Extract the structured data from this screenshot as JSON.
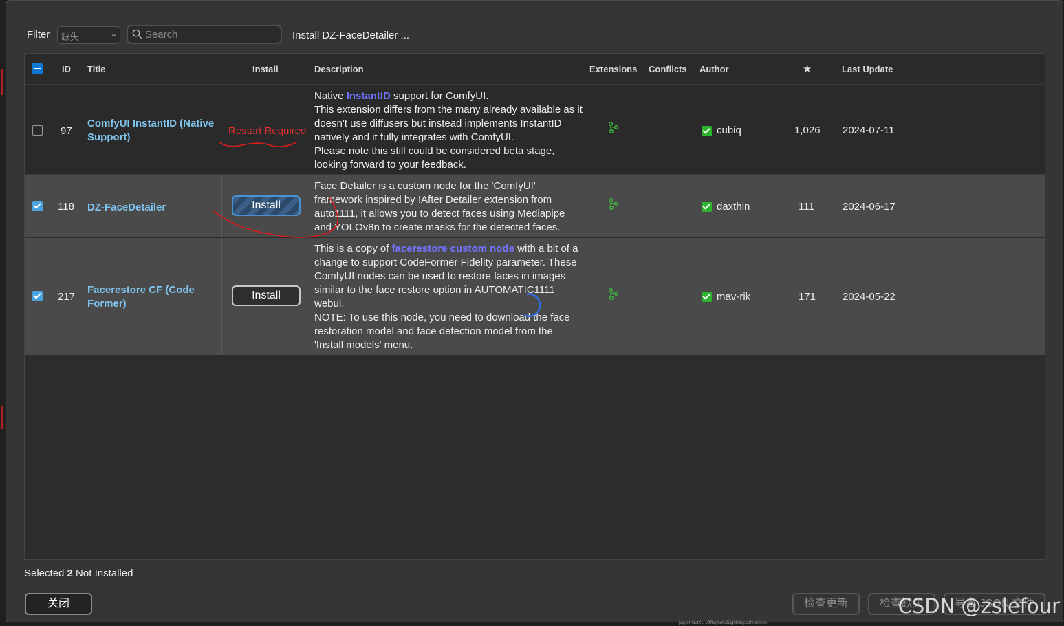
{
  "toolbar": {
    "filter_label": "Filter",
    "filter_value": "缺失",
    "search_placeholder": "Search",
    "status_message": "Install DZ-FaceDetailer ..."
  },
  "columns": {
    "id": "ID",
    "title": "Title",
    "install": "Install",
    "description": "Description",
    "extensions": "Extensions",
    "conflicts": "Conflicts",
    "author": "Author",
    "stars": "★",
    "last_update": "Last Update"
  },
  "rows": [
    {
      "checked": false,
      "id": "97",
      "title": "ComfyUI InstantID (Native Support)",
      "install_state": "Restart Required",
      "description_lines": [
        [
          "Native ",
          "InstantID",
          " support for ComfyUI."
        ],
        "This extension differs from the many already available as it",
        "doesn't use diffusers but instead implements InstantID",
        "natively and it fully integrates with ComfyUI.",
        "Please note this still could be considered beta stage,",
        "looking forward to your feedback."
      ],
      "author": "cubiq",
      "stars": "1,026",
      "last_update": "2024-07-11"
    },
    {
      "checked": true,
      "id": "118",
      "title": "DZ-FaceDetailer",
      "install_state": "Install",
      "description_lines": [
        "Face Detailer is a custom node for the 'ComfyUI'",
        "framework inspired by !After Detailer extension from",
        "auto1111, it allows you to detect faces using Mediapipe",
        "and YOLOv8n to create masks for the detected faces."
      ],
      "author": "daxthin",
      "stars": "111",
      "last_update": "2024-06-17"
    },
    {
      "checked": true,
      "id": "217",
      "title": "Facerestore CF (Code Former)",
      "install_state": "Install",
      "description_lines": [
        [
          "This is a copy of ",
          "facerestore custom node",
          " with a bit of a"
        ],
        "change to support CodeFormer Fidelity parameter. These",
        "ComfyUI nodes can be used to restore faces in images",
        "similar to the face restore option in AUTOMATIC1111",
        "webui.",
        "NOTE: To use this node, you need to download the face",
        "restoration model and face detection model from the",
        "'Install models' menu."
      ],
      "author": "mav-rik",
      "stars": "171",
      "last_update": "2024-05-22"
    }
  ],
  "footer": {
    "selected_prefix": "Selected ",
    "selected_count": "2",
    "selected_suffix": " Not Installed",
    "close_label": "关闭",
    "check_update_label": "检查更新",
    "check_missing_label": "检查缺失",
    "third_button_label": "导出 JSON 文件",
    "watermark": "CSDN @zslefour",
    "bottom_filename": "juggernautXL_v9Rdphoto2Lightning.safetensors"
  },
  "colors": {
    "link": "#7fc4ee",
    "desc_link": "#7373ff",
    "restart": "#e53030",
    "check_blue": "#4aa3df",
    "author_check": "#2cb32c"
  }
}
